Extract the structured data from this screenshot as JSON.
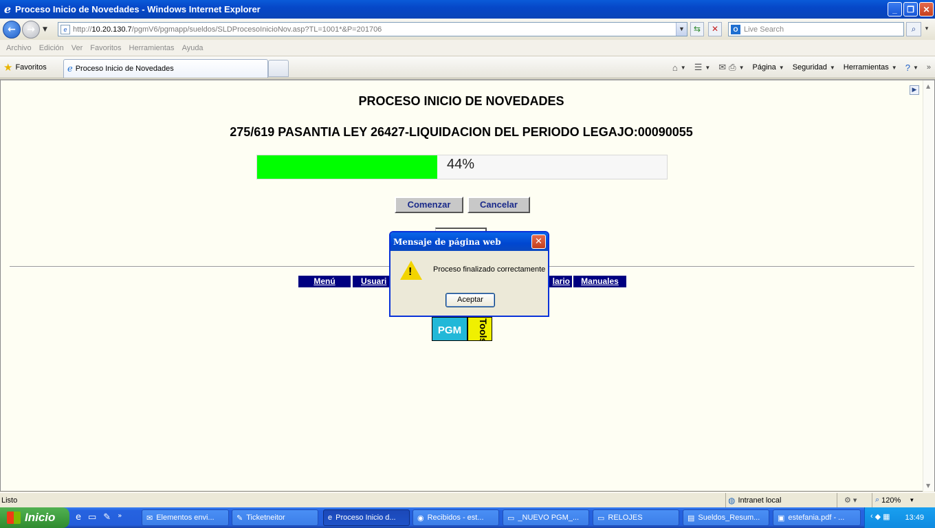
{
  "window": {
    "title": "Proceso Inicio de Novedades - Windows Internet Explorer",
    "minimize_glyph": "_",
    "maximize_glyph": "❐",
    "close_glyph": "✕"
  },
  "address": {
    "url_prefix": "http://",
    "url_host": "10.20.130.7",
    "url_path": "/pgmV6/pgmapp/sueldos/SLDProcesoInicioNov.asp?TL=1001*&P=201706"
  },
  "search": {
    "placeholder": "Live Search"
  },
  "menu": [
    "Archivo",
    "Edición",
    "Ver",
    "Favoritos",
    "Herramientas",
    "Ayuda"
  ],
  "favorites": {
    "label": "Favoritos"
  },
  "tab": {
    "label": "Proceso Inicio de Novedades"
  },
  "commandbar": {
    "page": "Página",
    "security": "Seguridad",
    "tools": "Herramientas"
  },
  "page": {
    "heading": "PROCESO INICIO DE NOVEDADES",
    "subheading": "275/619 PASANTIA LEY 26427-LIQUIDACION DEL PERIODO LEGAJO:00090055",
    "progress_percent": 44,
    "progress_label": "44%",
    "progress_color": "#00ff00",
    "start_button": "Comenzar",
    "cancel_button": "Cancelar",
    "nav_links": [
      "Menú",
      "Usuari",
      "lario",
      "Manuales"
    ],
    "logo_pgm": "PGM",
    "logo_tools": "Tools"
  },
  "dialog": {
    "title": "Mensaje de página web",
    "message": "Proceso finalizado correctamente",
    "ok_button": "Aceptar"
  },
  "status": {
    "text": "Listo",
    "zone": "Intranet local",
    "zoom": "120%"
  },
  "taskbar": {
    "start_label": "Inicio",
    "items": [
      "Elementos envi...",
      "Ticketneitor",
      "Proceso Inicio d...",
      "Recibidos - est...",
      "_NUEVO PGM_...",
      "RELOJES",
      "Sueldos_Resum...",
      "estefania.pdf - ..."
    ],
    "clock": "13:49"
  },
  "colors": {
    "nav_bg": "#000080",
    "titlebar": "#0a5bd8",
    "button_text": "#1a2a8a"
  },
  "icons": {
    "back": "back-arrow-icon",
    "forward": "forward-arrow-icon",
    "refresh": "refresh-icon",
    "stop": "stop-icon",
    "search": "search-icon",
    "favorites": "star-icon",
    "warning": "warning-icon"
  }
}
